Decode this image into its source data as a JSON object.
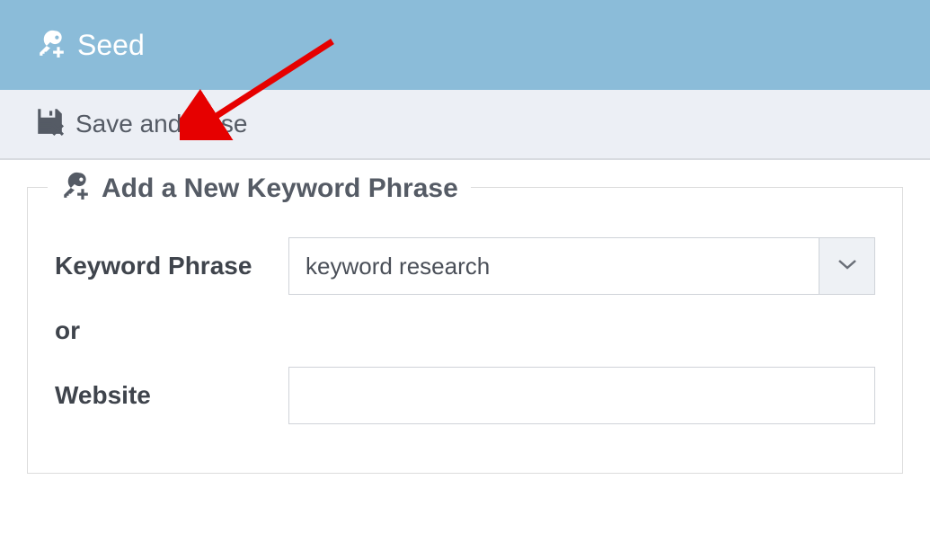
{
  "header": {
    "title": "Seed"
  },
  "toolbar": {
    "save_and_close_label": "Save and close"
  },
  "form": {
    "legend": "Add a New Keyword Phrase",
    "keyword_label": "Keyword Phrase",
    "keyword_value": "keyword research",
    "or_label": "or",
    "website_label": "Website",
    "website_value": ""
  }
}
